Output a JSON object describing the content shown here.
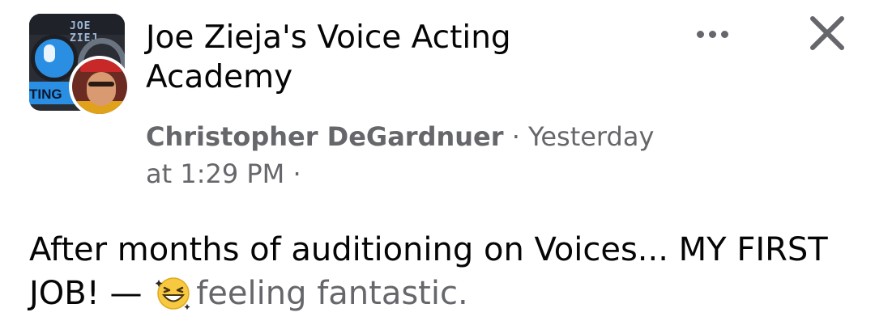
{
  "group": {
    "name": "Joe Zieja's Voice Acting Academy",
    "logo_text": "JOE ZIEJ",
    "logo_strip_text": "TING"
  },
  "post": {
    "author": "Christopher DeGardnuer",
    "separator": " · ",
    "timestamp": "Yesterday at 1:29 PM",
    "trailing_separator": " ·",
    "text": "After months of auditioning on Voices... MY FIRST JOB!",
    "dash": " — ",
    "feeling": "feeling fantastic.",
    "feeling_icon": "grinning-squinting-face-icon"
  },
  "header": {
    "more_icon": "more-options-icon",
    "close_icon": "close-icon"
  },
  "colors": {
    "text_primary": "#050505",
    "text_secondary": "#65676b",
    "brand_blue": "#2a8fe3"
  }
}
